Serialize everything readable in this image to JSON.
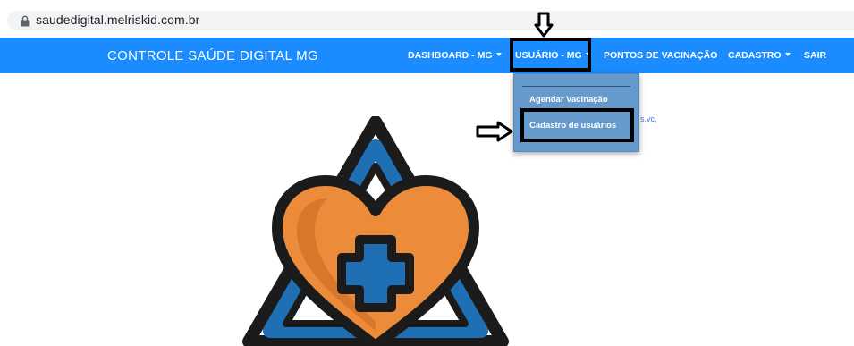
{
  "browser": {
    "url": "saudedigital.melriskid.com.br"
  },
  "navbar": {
    "brand": "CONTROLE SAÚDE DIGITAL MG",
    "items": [
      {
        "label": "DASHBOARD - MG",
        "dropdown": true
      },
      {
        "label": "USUÁRIO - MG",
        "dropdown": true,
        "highlighted": true
      },
      {
        "label": "PONTOS DE VACINAÇÃO",
        "dropdown": false
      },
      {
        "label": "CADASTRO",
        "dropdown": true
      },
      {
        "label": "SAIR",
        "dropdown": false
      }
    ]
  },
  "dropdown_menu": {
    "items": [
      {
        "label": "Agendar Vacinação"
      },
      {
        "label": "Cadastro de usuários",
        "highlighted": true
      }
    ]
  },
  "background_link": "s.vc,",
  "colors": {
    "navbar": "#1a8cff",
    "dropdown": "#6699cc",
    "logo_blue": "#1f6fb5",
    "logo_orange": "#ec8b3a"
  },
  "icons": [
    "lock-icon",
    "arrow-down-icon",
    "arrow-right-icon",
    "health-logo"
  ]
}
